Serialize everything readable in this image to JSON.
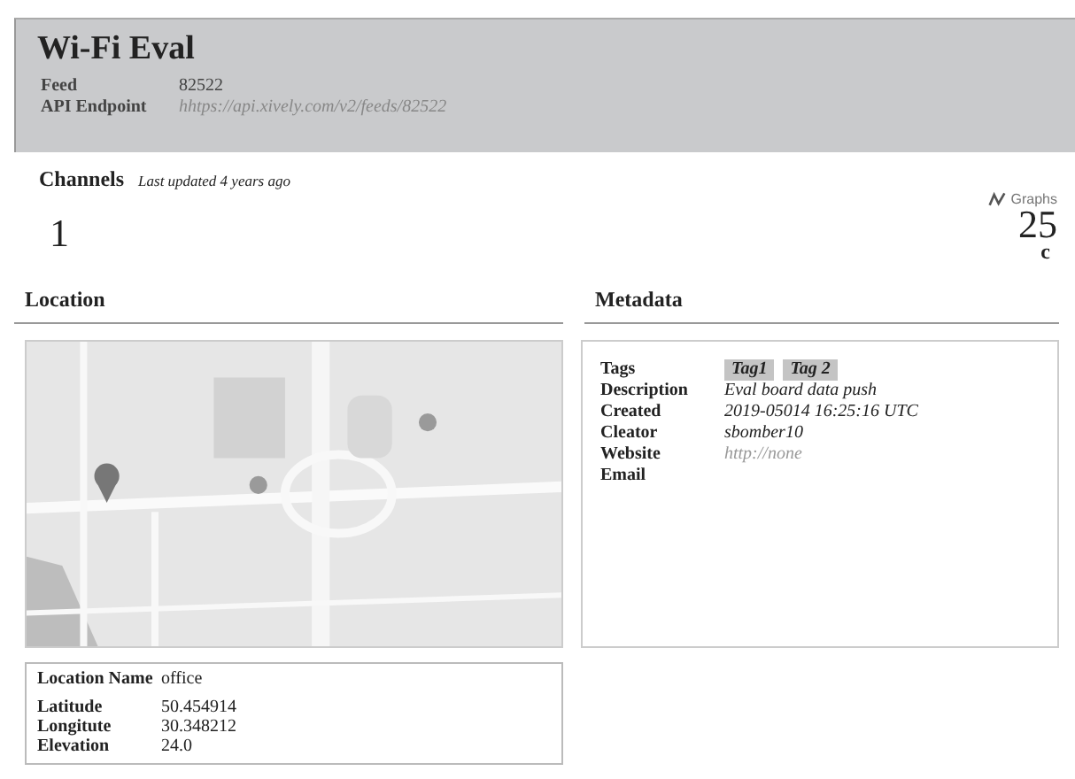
{
  "feed": {
    "title": "Wi-Fi Eval",
    "fields": [
      {
        "label": "Feed",
        "value": "82522",
        "kind": "text"
      },
      {
        "label": "API Endpoint",
        "value": "hhtps://api.xively.com/v2/feeds/82522",
        "kind": "link"
      }
    ]
  },
  "channels": {
    "title": "Channels",
    "updated": "Last updated 4 years ago",
    "count": "1",
    "graphs_label": "Graphs",
    "value": "25",
    "unit": "c"
  },
  "location": {
    "title": "Location",
    "name_label": "Location Name",
    "name": "office",
    "fields": [
      {
        "label": "Latitude",
        "value": "50.454914"
      },
      {
        "label": "Longitute",
        "value": "30.348212"
      },
      {
        "label": "Elevation",
        "value": "24.0"
      }
    ]
  },
  "metadata": {
    "title": "Metadata",
    "rows": [
      {
        "label": "Tags",
        "kind": "tags",
        "tags": [
          "Tag1",
          "Tag 2"
        ]
      },
      {
        "label": "Description",
        "kind": "text",
        "value": "Eval board data push"
      },
      {
        "label": "Created",
        "kind": "text",
        "value": "2019-05014  16:25:16 UTC"
      },
      {
        "label": "Cleator",
        "kind": "text",
        "value": "sbomber10"
      },
      {
        "label": "Website",
        "kind": "link",
        "value": "http://none"
      },
      {
        "label": "Email",
        "kind": "empty"
      }
    ]
  }
}
